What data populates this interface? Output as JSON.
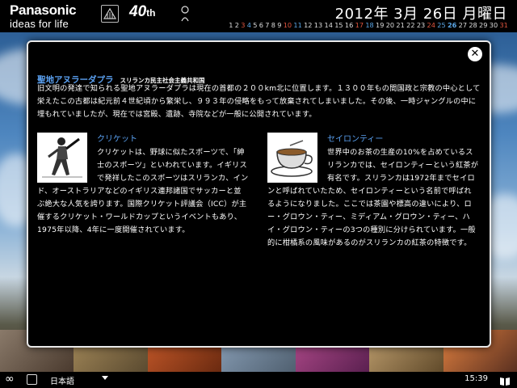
{
  "header": {
    "brand_name": "Panasonic",
    "brand_slogan": "ideas for life",
    "anniversary_mark": "40",
    "date_title": "2012年 3月 26日 月曜日",
    "days": [
      {
        "n": "1",
        "t": "d"
      },
      {
        "n": "2",
        "t": "d"
      },
      {
        "n": "3",
        "t": "sat"
      },
      {
        "n": "4",
        "t": "sun"
      },
      {
        "n": "5",
        "t": "d"
      },
      {
        "n": "6",
        "t": "d"
      },
      {
        "n": "7",
        "t": "d"
      },
      {
        "n": "8",
        "t": "d"
      },
      {
        "n": "9",
        "t": "d"
      },
      {
        "n": "10",
        "t": "sat"
      },
      {
        "n": "11",
        "t": "sun"
      },
      {
        "n": "12",
        "t": "d"
      },
      {
        "n": "13",
        "t": "d"
      },
      {
        "n": "14",
        "t": "d"
      },
      {
        "n": "15",
        "t": "d"
      },
      {
        "n": "16",
        "t": "d"
      },
      {
        "n": "17",
        "t": "sat"
      },
      {
        "n": "18",
        "t": "sun"
      },
      {
        "n": "19",
        "t": "d"
      },
      {
        "n": "20",
        "t": "d"
      },
      {
        "n": "21",
        "t": "d"
      },
      {
        "n": "22",
        "t": "d"
      },
      {
        "n": "23",
        "t": "d"
      },
      {
        "n": "24",
        "t": "sat"
      },
      {
        "n": "25",
        "t": "sun"
      },
      {
        "n": "26",
        "t": "today"
      },
      {
        "n": "27",
        "t": "d"
      },
      {
        "n": "28",
        "t": "d"
      },
      {
        "n": "29",
        "t": "d"
      },
      {
        "n": "30",
        "t": "d"
      },
      {
        "n": "31",
        "t": "sat"
      }
    ]
  },
  "modal": {
    "close_icon": "close-icon",
    "heading": "聖地アヌラーダプラ",
    "heading_sub": "スリランカ民主社会主義共和国",
    "intro": "旧文明の発達で知られる聖地アヌラーダプラは現在の首都の２００km北に位置します。１３００年もの間国政と宗教の中心として栄えたこの古都は紀元前４世紀頃から繁栄し、９９３年の侵略をもって放棄されてしまいました。その後、一時ジャングルの中に埋もれていましたが、現在では宮殿、遺跡、寺院などが一般に公開されています。",
    "left": {
      "title": "クリケット",
      "text": "クリケットは、野球に似たスポーツで、「紳士のスポーツ」といわれています。イギリスで発祥したこのスポーツはスリランカ、インド、オーストラリアなどのイギリス連邦諸国でサッカーと並ぶ絶大な人気を誇ります。国際クリケット評議会（ICC）が主催するクリケット・ワールドカップというイベントもあり、1975年以降、4年に一度開催されています。"
    },
    "right": {
      "title": "セイロンティー",
      "text": "世界中のお茶の生産の10%を占めているスリランカでは、セイロンティーという紅茶が有名です。スリランカは1972年までセイロンと呼ばれていたため、セイロンティーという名前で呼ばれるようになりました。ここでは茶園や標高の違いにより、ロー・グロウン・ティー、ミディアム・グロウン・ティー、ハイ・グロウン・ティーの3つの種別に分けられています。一般的に柑橘系の風味があるのがスリランカの紅茶の特徴です。"
    }
  },
  "bottom": {
    "infinity_icon": "∞",
    "language": "日本語",
    "time": "15:39"
  },
  "colors": {
    "accent_blue": "#5aa0f0",
    "sunday": "#5aa6e6",
    "saturday": "#e0553f"
  }
}
